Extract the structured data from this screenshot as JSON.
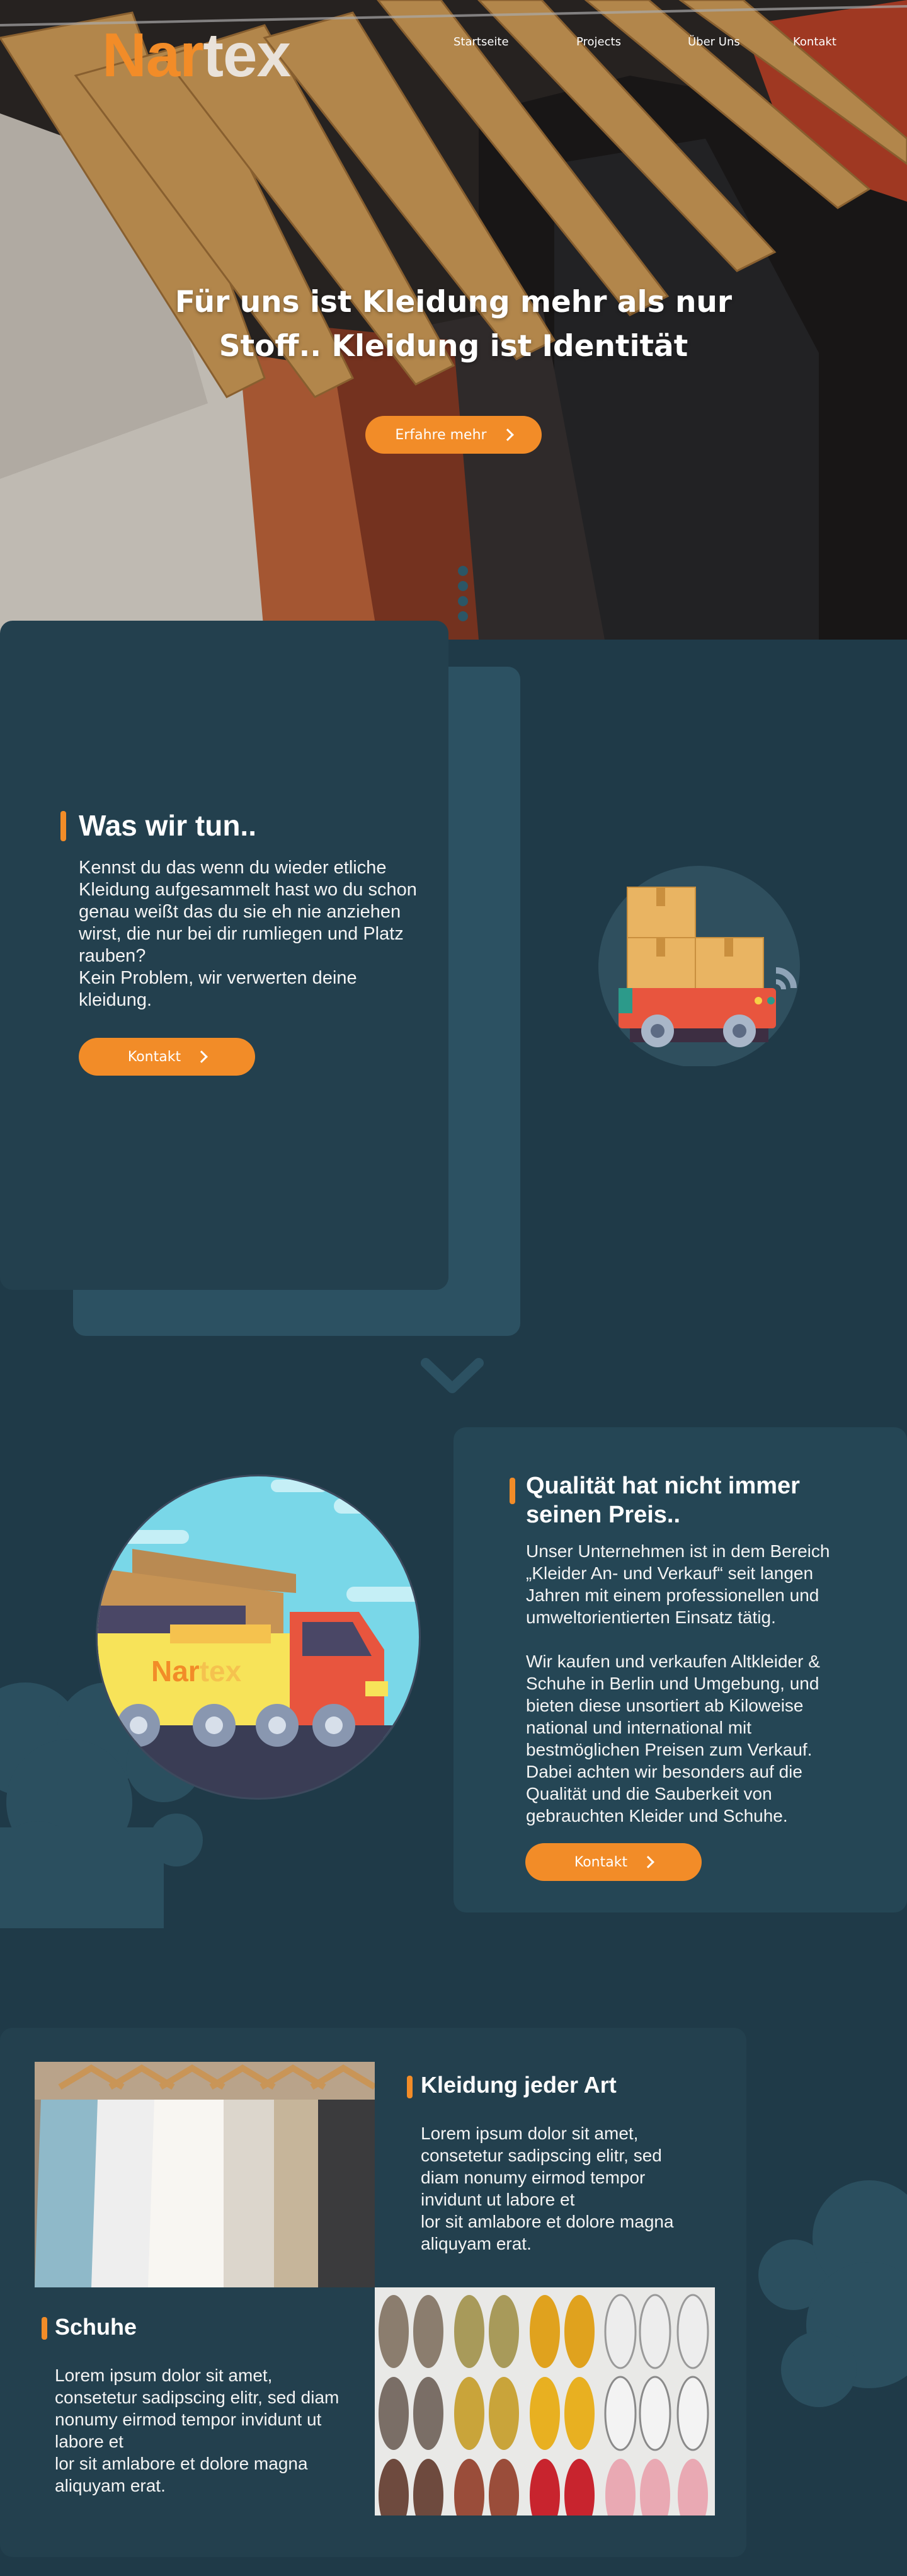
{
  "logo": {
    "part1": "Nar",
    "part2": "tex"
  },
  "nav": {
    "items": [
      "Startseite",
      "Projects",
      "Über Uns",
      "Kontakt"
    ]
  },
  "hero": {
    "headline": "Für uns ist Kleidung mehr als nur Stoff.. Kleidung ist Identität",
    "cta_label": "Erfahre mehr"
  },
  "section_what": {
    "title": "Was wir tun..",
    "body": "Kennst du das wenn du wieder etliche Kleidung aufgesammelt hast wo du schon genau weißt das du sie eh nie anziehen wirst, die nur bei dir rumliegen und Platz rauben?\nKein Problem, wir verwerten deine kleidung.",
    "cta_label": "Kontakt"
  },
  "section_quality": {
    "title": "Qualität hat nicht immer seinen Preis..",
    "body": "Unser Unternehmen ist in dem Bereich „Kleider An- und Verkauf“ seit langen Jahren mit einem professionellen und umweltorientierten Einsatz tätig.\n\nWir kaufen und verkaufen Altkleider & Schuhe in Berlin und Umgebung, und bieten diese unsortiert ab  Kiloweise national und international mit bestmöglichen Preisen zum Verkauf. Dabei achten wir besonders auf die Qualität und die Sauberkeit von gebrauchten Kleider und Schuhe.",
    "cta_label": "Kontakt",
    "truck_logo": {
      "part1": "Nar",
      "part2": "tex"
    }
  },
  "section_products": {
    "clothes": {
      "title": "Kleidung jeder Art",
      "body": "Lorem ipsum dolor sit amet, consetetur sadipscing elitr, sed diam nonumy eirmod tempor invidunt ut labore et\nlor sit amlabore et dolore magna aliquyam erat."
    },
    "shoes": {
      "title": "Schuhe",
      "body": "Lorem ipsum dolor sit amet, consetetur sadipscing elitr, sed diam nonumy eirmod tempor invidunt ut labore et\nlor sit amlabore et dolore magna aliquyam erat."
    }
  },
  "colors": {
    "accent": "#f28c28",
    "background": "#1f3a48",
    "card": "#23404e",
    "card_light": "#2c5162"
  }
}
